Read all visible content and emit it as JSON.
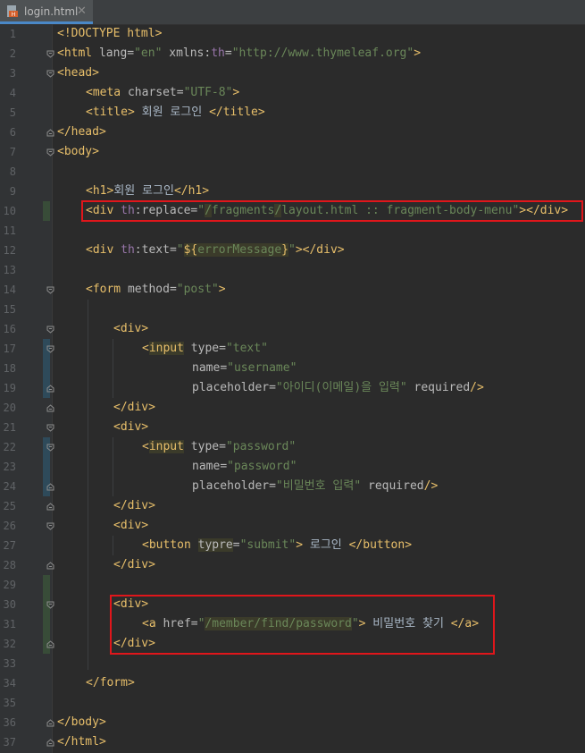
{
  "tab": {
    "filename": "login.html",
    "close_glyph": "✕",
    "icon": "html-file-icon"
  },
  "line_numbers": [
    "1",
    "2",
    "3",
    "4",
    "5",
    "6",
    "7",
    "8",
    "9",
    "10",
    "11",
    "12",
    "13",
    "14",
    "15",
    "16",
    "17",
    "18",
    "19",
    "20",
    "21",
    "22",
    "23",
    "24",
    "25",
    "26",
    "27",
    "28",
    "29",
    "30",
    "31",
    "32",
    "33",
    "34",
    "35",
    "36",
    "37"
  ],
  "code": {
    "l1_doctype": "<!DOCTYPE html>",
    "l2_open": "<html ",
    "l2_attr1": "lang",
    "l2_eq1": "=",
    "l2_val1": "\"en\"",
    "l2_attr2": " xmlns:",
    "l2_ns": "th",
    "l2_eq2": "=",
    "l2_val2": "\"http://www.thymeleaf.org\"",
    "l2_close": ">",
    "l3": "<head>",
    "l4_open": "<meta ",
    "l4_attr": "charset",
    "l4_eq": "=",
    "l4_val": "\"UTF-8\"",
    "l4_close": ">",
    "l5_open": "<title>",
    "l5_text": " 회원 로그인 ",
    "l5_close": "</title>",
    "l6": "</head>",
    "l7": "<body>",
    "l9_open": "<h1>",
    "l9_text": "회원 로그인",
    "l9_close": "</h1>",
    "l10_open": "<div ",
    "l10_ns": "th",
    "l10_attr": ":replace",
    "l10_eq": "=",
    "l10_q1": "\"",
    "l10_v1": "/",
    "l10_v2": "fragments",
    "l10_v3": "/",
    "l10_v4": "layout.html :: fragment-body-menu",
    "l10_q2": "\"",
    "l10_close": "></div>",
    "l12_open": "<div ",
    "l12_ns": "th",
    "l12_attr": ":text",
    "l12_eq": "=",
    "l12_q1": "\"",
    "l12_expr1": "${",
    "l12_expr2": "errorMessage",
    "l12_expr3": "}",
    "l12_q2": "\"",
    "l12_close": "></div>",
    "l14_open": "<form ",
    "l14_attr": "method",
    "l14_eq": "=",
    "l14_val": "\"post\"",
    "l14_close": ">",
    "l16": "<div>",
    "l17_lt": "<",
    "l17_tag": "input",
    "l17_sp": " ",
    "l17_attr": "type",
    "l17_eq": "=",
    "l17_val": "\"text\"",
    "l18_attr": "name",
    "l18_eq": "=",
    "l18_val": "\"username\"",
    "l19_attr": "placeholder",
    "l19_eq": "=",
    "l19_val": "\"아이디(이메일)을 입력\"",
    "l19_req": " required",
    "l19_close": "/>",
    "l20": "</div>",
    "l21": "<div>",
    "l22_lt": "<",
    "l22_tag": "input",
    "l22_sp": " ",
    "l22_attr": "type",
    "l22_eq": "=",
    "l22_val": "\"password\"",
    "l23_attr": "name",
    "l23_eq": "=",
    "l23_val": "\"password\"",
    "l24_attr": "placeholder",
    "l24_eq": "=",
    "l24_val": "\"비밀번호 입력\"",
    "l24_req": " required",
    "l24_close": "/>",
    "l25": "</div>",
    "l26": "<div>",
    "l27_open": "<button ",
    "l27_attr": "typre",
    "l27_eq": "=",
    "l27_val": "\"submit\"",
    "l27_gt": ">",
    "l27_text": " 로그인 ",
    "l27_close": "</button>",
    "l28": "</div>",
    "l30": "<div>",
    "l31_open": "<a ",
    "l31_attr": "href",
    "l31_eq": "=",
    "l31_q1": "\"",
    "l31_val": "/member/find/password",
    "l31_q2": "\"",
    "l31_gt": ">",
    "l31_text": " 비밀번호 찾기 ",
    "l31_close": "</a>",
    "l32": "</div>",
    "l34": "</form>",
    "l36": "</body>",
    "l37": "</html>"
  }
}
